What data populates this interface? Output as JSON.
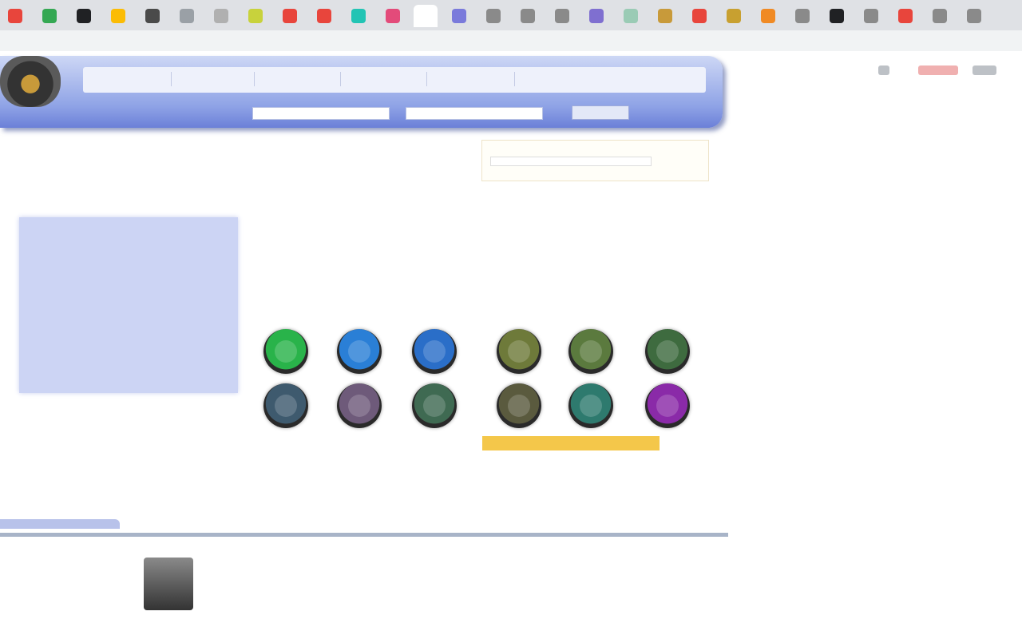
{
  "browser": {
    "tabs_colors": [
      "#e8453c",
      "#34a853",
      "#202124",
      "#fbbc05",
      "#4a4a4a",
      "#9aa0a6",
      "#b0b0b0",
      "#c8d23c",
      "#e8453c",
      "#e8453c",
      "#22c4b4",
      "#e34b7a",
      "#7a7adb",
      "#8a8a8a",
      "#8a8a8a",
      "#8a8a8a",
      "#7f6fd0",
      "#9acbb5",
      "#c89a3a",
      "#e8453c",
      "#c8a030",
      "#f08a24",
      "#8a8a8a",
      "#202124",
      "#8a8a8a",
      "#e8453c",
      "#8a8a8a",
      "#8a8a8a"
    ],
    "url": "",
    "toolbar_icons": [
      "star-icon",
      "extension-icon",
      "profile-icon"
    ]
  },
  "header": {
    "nav_items": [
      "",
      "",
      "",
      "",
      "",
      "",
      ""
    ],
    "site_title": "",
    "search_placeholder_1": "",
    "search_placeholder_2": "",
    "search_button": ""
  },
  "login": {
    "line1": "",
    "line2": "",
    "line3": ""
  },
  "welcome": {
    "title": ""
  },
  "left_panel": {
    "paragraphs": [
      "",
      "",
      ""
    ]
  },
  "intro": {
    "text": ""
  },
  "badges": {
    "colors": [
      "#29b34a",
      "#2a7fd6",
      "#2a6ec8",
      "#6e7a3a",
      "#5b7a3e",
      "#3e6b3f",
      "#3e5a6e",
      "#6e5a7a",
      "#3f6a52",
      "#5a5a3e",
      "#2e7a6e",
      "#8a2aa8"
    ]
  },
  "promo": {
    "line1": "",
    "line2": "",
    "line3": ""
  },
  "footer": {
    "links": "",
    "copyright": ""
  }
}
